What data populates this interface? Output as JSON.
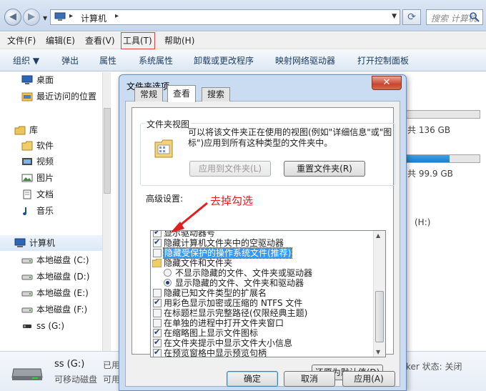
{
  "explorer": {
    "nav_back": "◀",
    "nav_forward": "▶",
    "path_root_sep": "▸",
    "path": "计算机",
    "path_sep": "▸",
    "search_placeholder": "搜索 计算机",
    "menu": [
      "文件(F)",
      "编辑(E)",
      "查看(V)",
      "工具(T)",
      "帮助(H)"
    ],
    "toolbar": [
      "组织 ▼",
      "弹出",
      "属性",
      "系统属性",
      "卸载或更改程序",
      "映射网络驱动器",
      "打开控制面板"
    ],
    "sidebar": [
      {
        "label": "桌面",
        "icon": "desktop-icon"
      },
      {
        "label": "最近访问的位置",
        "icon": "recent-places-icon"
      },
      {
        "label": "库",
        "icon": "library-icon"
      },
      {
        "label": "软件",
        "icon": "folder-icon"
      },
      {
        "label": "视频",
        "icon": "video-icon"
      },
      {
        "label": "图片",
        "icon": "pictures-icon"
      },
      {
        "label": "文档",
        "icon": "documents-icon"
      },
      {
        "label": "音乐",
        "icon": "music-icon"
      },
      {
        "label": "计算机",
        "icon": "computer-icon"
      },
      {
        "label": "本地磁盘 (C:)",
        "icon": "drive-icon"
      },
      {
        "label": "本地磁盘 (D:)",
        "icon": "drive-icon"
      },
      {
        "label": "本地磁盘 (E:)",
        "icon": "drive-icon"
      },
      {
        "label": "本地磁盘 (F:)",
        "icon": "drive-icon"
      },
      {
        "label": "ss (G:)",
        "icon": "usb-drive-icon"
      }
    ],
    "content": {
      "drive1_free": "共 136 GB",
      "drive1_fill": 0.02,
      "drive2_free": "共 99.9 GB",
      "drive2_fill": 0.62,
      "drive_h": "(H:)"
    },
    "status": {
      "name": "ss (G:)",
      "type": "可移动磁盘",
      "used_label": "已用",
      "avail_label": "可用",
      "bitlocker": "ker 状态: 关闭"
    }
  },
  "dialog": {
    "title": "文件夹选项",
    "close": "✕",
    "tabs": [
      "常规",
      "查看",
      "搜索"
    ],
    "folder_view": {
      "group_title": "文件夹视图",
      "description": "可以将该文件夹正在使用的视图(例如\"详细信息\"或\"图标\")应用到所有这种类型的文件夹中。",
      "apply_button": "应用到文件夹(L)",
      "reset_button": "重置文件夹(R)"
    },
    "advanced_label": "高级设置:",
    "annotation": "去掉勾选",
    "advanced_items": [
      {
        "kind": "check",
        "checked": true,
        "text": "显示驱动器号"
      },
      {
        "kind": "check",
        "checked": true,
        "text": "隐藏计算机文件夹中的空驱动器"
      },
      {
        "kind": "check",
        "checked": false,
        "text": "隐藏受保护的操作系统文件(推荐)",
        "highlight": true
      },
      {
        "kind": "folder",
        "text": "隐藏文件和文件夹"
      },
      {
        "kind": "radio",
        "checked": false,
        "text": "不显示隐藏的文件、文件夹或驱动器"
      },
      {
        "kind": "radio",
        "checked": true,
        "text": "显示隐藏的文件、文件夹和驱动器"
      },
      {
        "kind": "check",
        "checked": false,
        "text": "隐藏已知文件类型的扩展名"
      },
      {
        "kind": "check",
        "checked": true,
        "text": "用彩色显示加密或压缩的 NTFS 文件"
      },
      {
        "kind": "check",
        "checked": false,
        "text": "在标题栏显示完整路径(仅限经典主题)"
      },
      {
        "kind": "check",
        "checked": false,
        "text": "在单独的进程中打开文件夹窗口"
      },
      {
        "kind": "check",
        "checked": true,
        "text": "在缩略图上显示文件图标"
      },
      {
        "kind": "check",
        "checked": true,
        "text": "在文件夹提示中显示文件大小信息"
      },
      {
        "kind": "check",
        "checked": true,
        "text": "在预览窗格中显示预览句柄"
      }
    ],
    "restore_button": "还原为默认值(D)",
    "ok_button": "确定",
    "cancel_button": "取消",
    "apply_button": "应用(A)"
  }
}
